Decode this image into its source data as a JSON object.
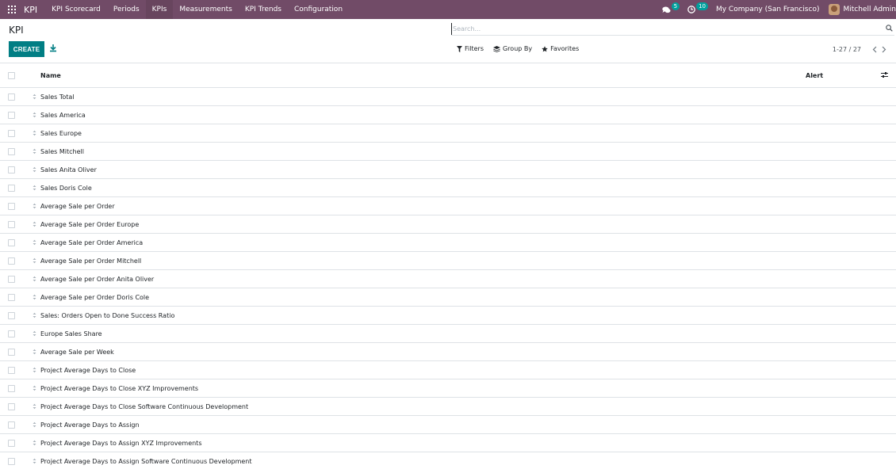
{
  "navbar": {
    "brand": "KPI",
    "menu": [
      "KPI Scorecard",
      "Periods",
      "KPIs",
      "Measurements",
      "KPI Trends",
      "Configuration"
    ],
    "active_index": 2,
    "messages_count": "5",
    "activities_count": "10",
    "company": "My Company (San Francisco)",
    "user": "Mitchell Admin"
  },
  "control_panel": {
    "breadcrumb": "KPI",
    "create_label": "CREATE",
    "search_placeholder": "Search...",
    "filters_label": "Filters",
    "group_by_label": "Group By",
    "favorites_label": "Favorites",
    "pager_value": "1-27 / 27"
  },
  "list": {
    "columns": {
      "name": "Name",
      "alert": "Alert"
    },
    "rows": [
      "Sales Total",
      "Sales America",
      "Sales Europe",
      "Sales Mitchell",
      "Sales Anita Oliver",
      "Sales Doris Cole",
      "Average Sale per Order",
      "Average Sale per Order Europe",
      "Average Sale per Order America",
      "Average Sale per Order Mitchell",
      "Average Sale per Order Anita Oliver",
      "Average Sale per Order Doris Cole",
      "Sales: Orders Open to Done Success Ratio",
      "Europe Sales Share",
      "Average Sale per Week",
      "Project Average Days to Close",
      "Project Average Days to Close XYZ Improvements",
      "Project Average Days to Close Software Continuous Development",
      "Project Average Days to Assign",
      "Project Average Days to Assign XYZ Improvements",
      "Project Average Days to Assign Software Continuous Development"
    ]
  },
  "colors": {
    "navbar": "#714b67",
    "primary_button": "#017e84",
    "badge": "#00a09d"
  }
}
